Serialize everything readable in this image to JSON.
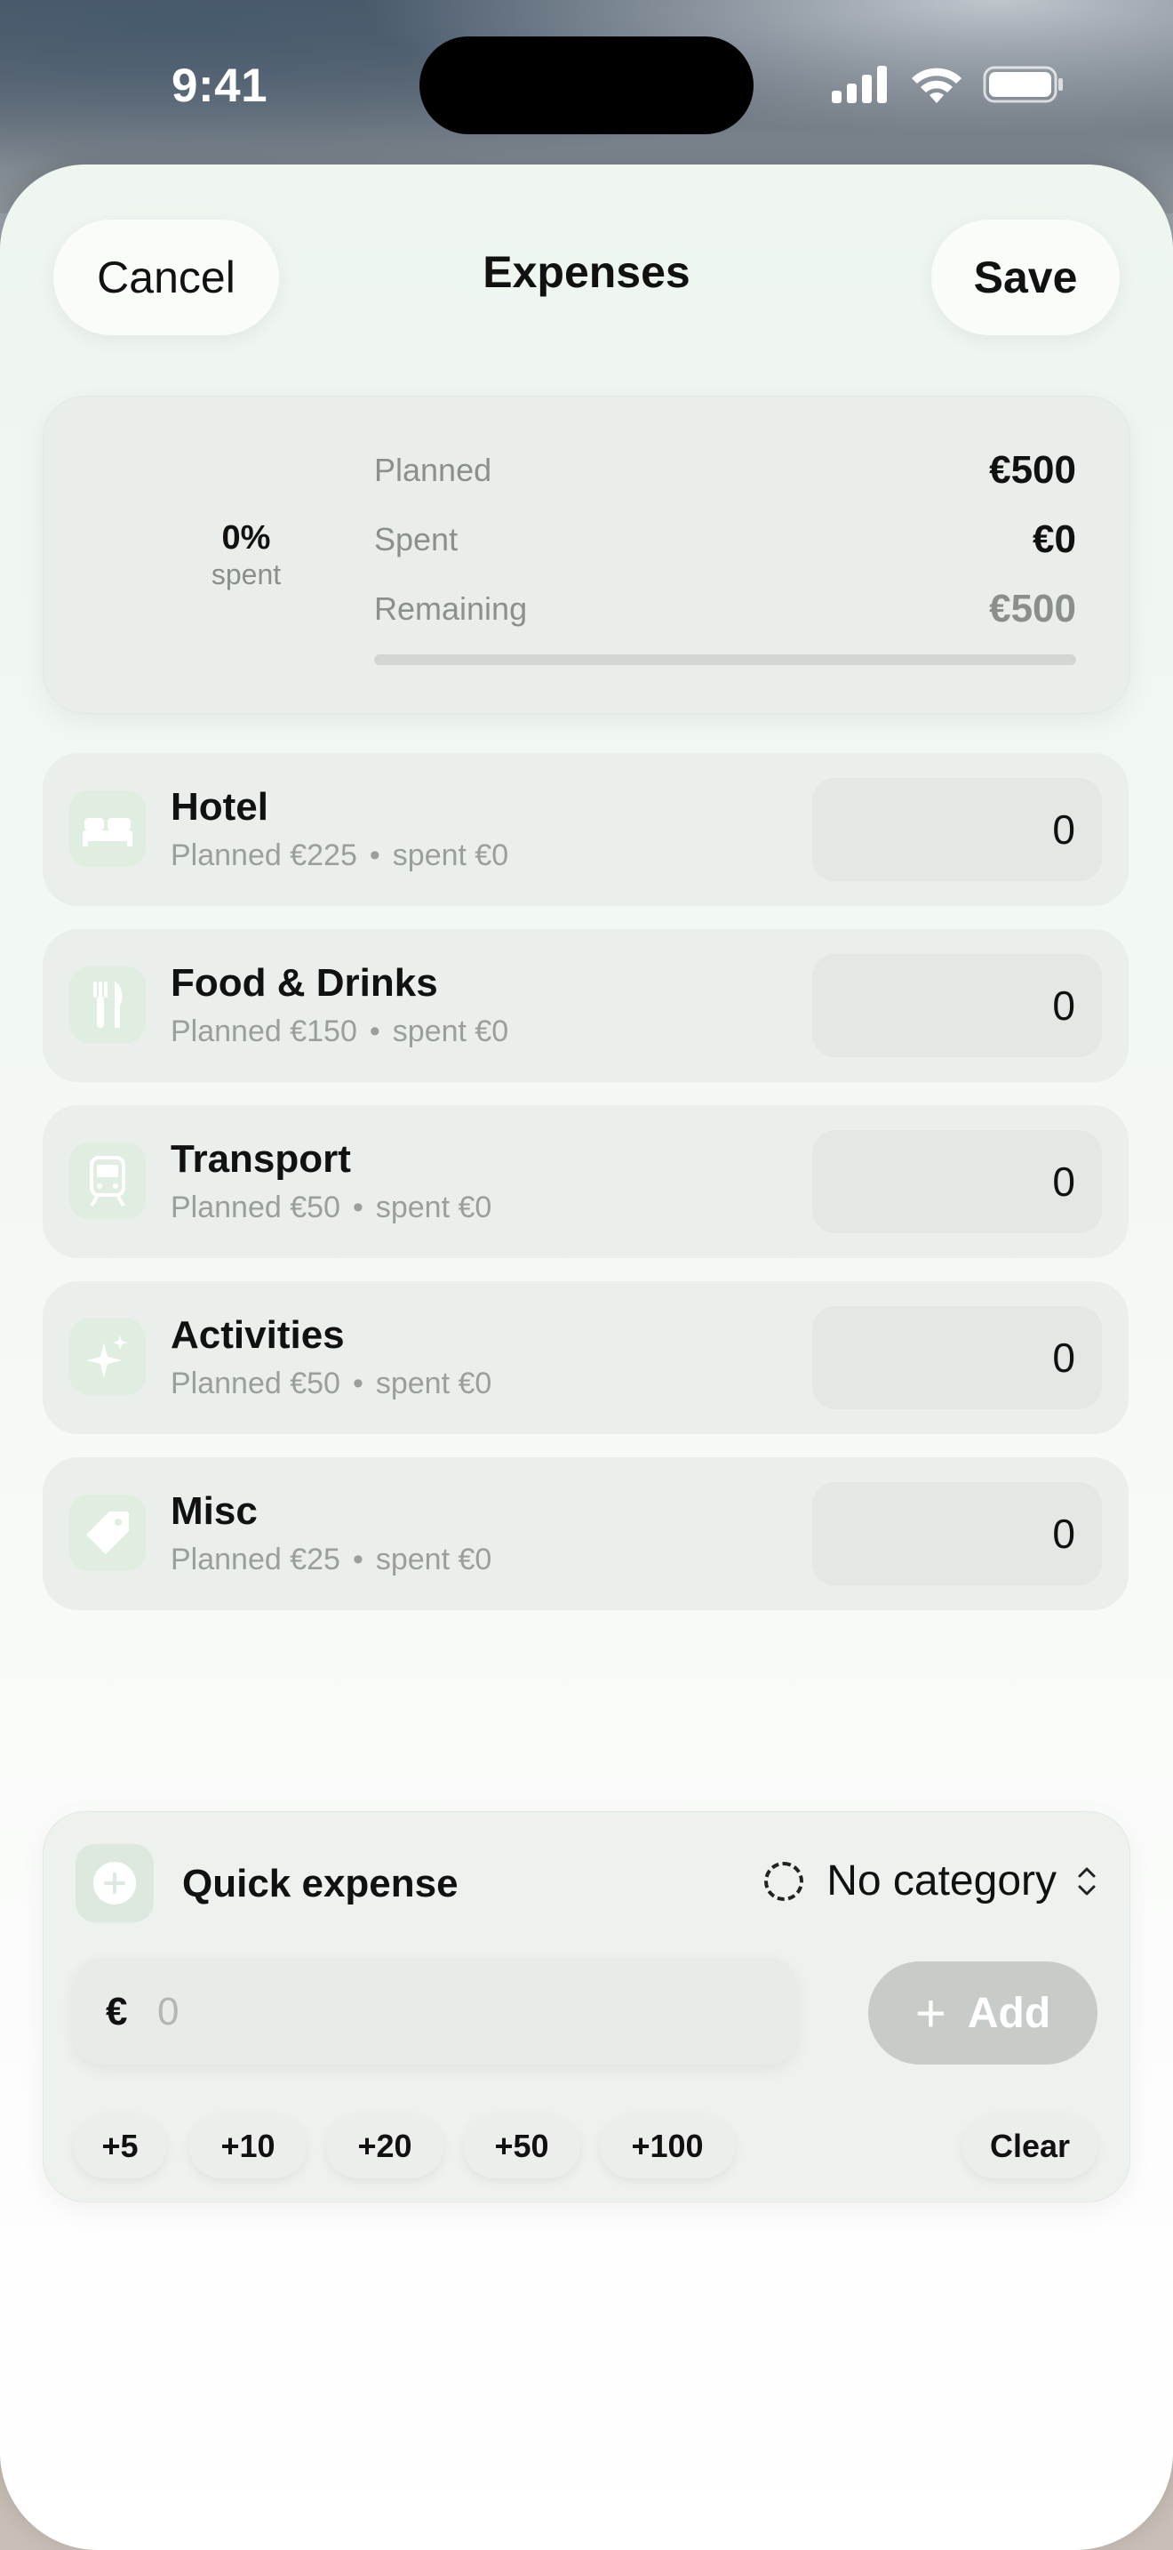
{
  "status": {
    "time": "9:41"
  },
  "header": {
    "cancel_label": "Cancel",
    "title": "Expenses",
    "save_label": "Save"
  },
  "summary": {
    "percent_label": "0%",
    "percent_caption": "spent",
    "planned_label": "Planned",
    "planned_value": "€500",
    "spent_label": "Spent",
    "spent_value": "€0",
    "remaining_label": "Remaining",
    "remaining_value": "€500",
    "progress_fraction": 0
  },
  "categories": [
    {
      "name": "Hotel",
      "planned": "Planned €225",
      "spent": "spent €0",
      "amount": "0",
      "icon": "bed-icon"
    },
    {
      "name": "Food & Drinks",
      "planned": "Planned €150",
      "spent": "spent €0",
      "amount": "0",
      "icon": "fork-knife-icon"
    },
    {
      "name": "Transport",
      "planned": "Planned €50",
      "spent": "spent €0",
      "amount": "0",
      "icon": "train-icon"
    },
    {
      "name": "Activities",
      "planned": "Planned €50",
      "spent": "spent €0",
      "amount": "0",
      "icon": "sparkles-icon"
    },
    {
      "name": "Misc",
      "planned": "Planned €25",
      "spent": "spent €0",
      "amount": "0",
      "icon": "tag-icon"
    }
  ],
  "separator": "•",
  "quick": {
    "title": "Quick expense",
    "category_label": "No category",
    "currency": "€",
    "amount_placeholder": "0",
    "add_label": "Add",
    "chips": [
      "+5",
      "+10",
      "+20",
      "+50",
      "+100"
    ],
    "clear_label": "Clear"
  },
  "colors": {
    "accent_green": "#6fae7c",
    "sheet_bg": "#eef6ef"
  }
}
